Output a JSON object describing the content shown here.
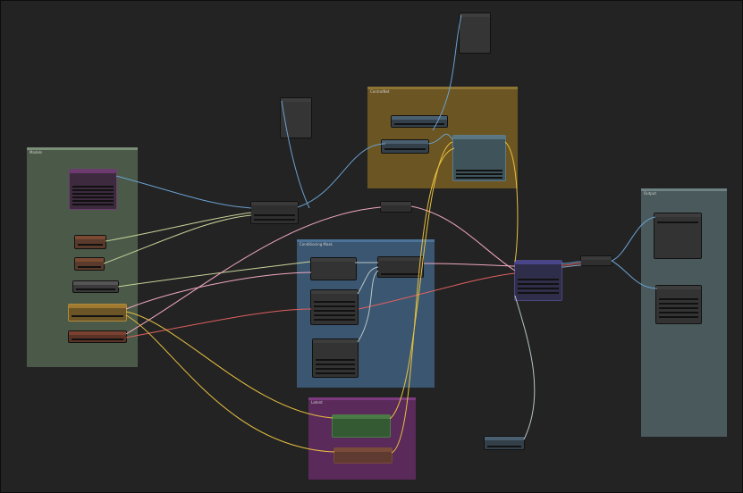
{
  "app": {
    "name": "node-graph-canvas"
  },
  "groups": [
    {
      "id": "group-left",
      "title": "Models",
      "color": "#4b5a48"
    },
    {
      "id": "group-top",
      "title": "ControlNet",
      "color": "#6b5522"
    },
    {
      "id": "group-mid",
      "title": "Conditioning Mask",
      "color": "#3b5670"
    },
    {
      "id": "group-bottom",
      "title": "Latent",
      "color": "#5a2a5a"
    },
    {
      "id": "group-right",
      "title": "Output",
      "color": "#4a5a5c"
    }
  ],
  "wire_colors": {
    "model": "#6aa0d0",
    "clip": "#c9d49a",
    "conditioning": "#f0a8c0",
    "vae": "#e06060",
    "latent": "#e8c040",
    "image": "#8aa6c8",
    "mask": "#b8c4c8"
  }
}
